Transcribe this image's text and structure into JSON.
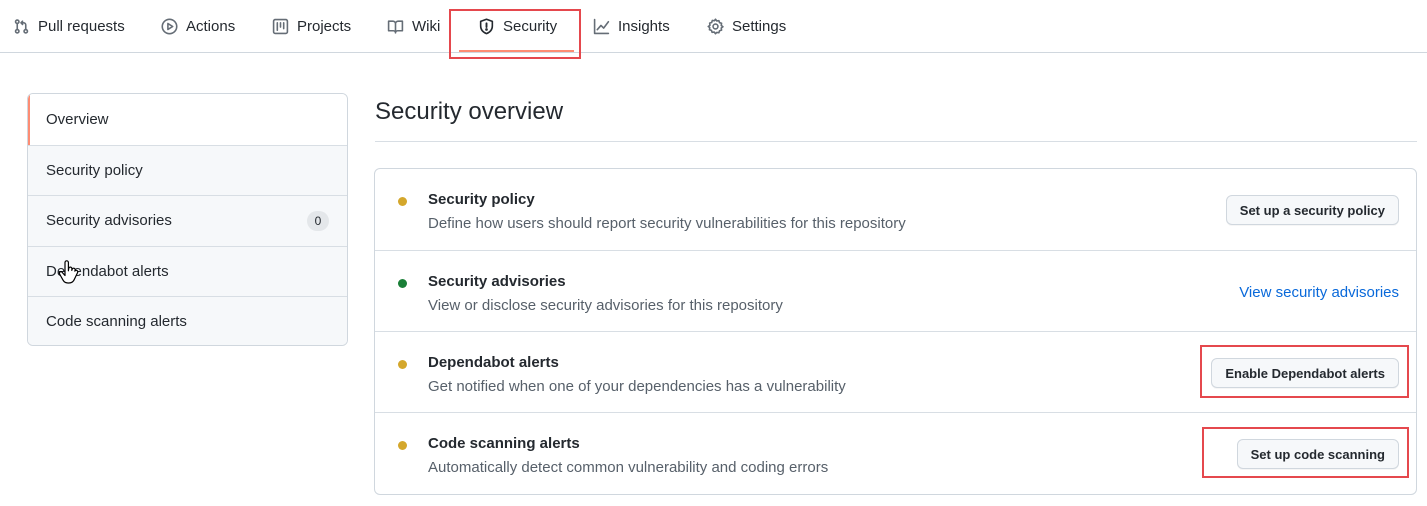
{
  "nav": {
    "tabs": [
      {
        "label": "Pull requests",
        "icon": "git-pull-request-icon"
      },
      {
        "label": "Actions",
        "icon": "play-icon"
      },
      {
        "label": "Projects",
        "icon": "project-icon"
      },
      {
        "label": "Wiki",
        "icon": "book-icon"
      },
      {
        "label": "Security",
        "icon": "shield-icon",
        "active": true
      },
      {
        "label": "Insights",
        "icon": "graph-icon"
      },
      {
        "label": "Settings",
        "icon": "gear-icon"
      }
    ]
  },
  "sidebar": {
    "items": [
      {
        "label": "Overview",
        "selected": true
      },
      {
        "label": "Security policy"
      },
      {
        "label": "Security advisories",
        "count": "0"
      },
      {
        "label": "Dependabot alerts"
      },
      {
        "label": "Code scanning alerts"
      }
    ]
  },
  "main": {
    "title": "Security overview",
    "rows": [
      {
        "title": "Security policy",
        "description": "Define how users should report security vulnerabilities for this repository",
        "status_color": "#d4a72c",
        "action": "Set up a security policy",
        "action_type": "button"
      },
      {
        "title": "Security advisories",
        "description": "View or disclose security advisories for this repository",
        "status_color": "#1a7f37",
        "action": "View security advisories",
        "action_type": "link"
      },
      {
        "title": "Dependabot alerts",
        "description": "Get notified when one of your dependencies has a vulnerability",
        "status_color": "#d4a72c",
        "action": "Enable Dependabot alerts",
        "action_type": "button"
      },
      {
        "title": "Code scanning alerts",
        "description": "Automatically detect common vulnerability and coding errors",
        "status_color": "#d4a72c",
        "action": "Set up code scanning",
        "action_type": "button"
      }
    ]
  },
  "colors": {
    "accent_underline": "#fd8c73",
    "highlight_box": "#e5484d",
    "link": "#0969da"
  }
}
